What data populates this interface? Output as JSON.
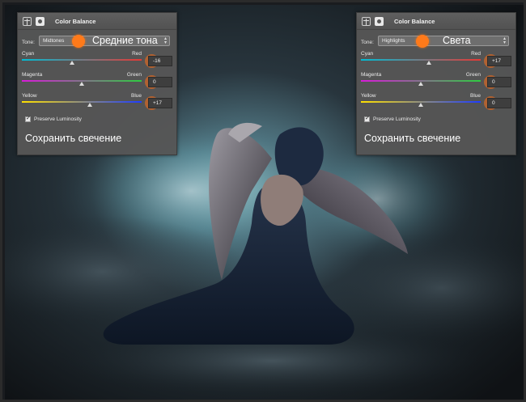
{
  "left_panel": {
    "title": "Color Balance",
    "tone_label": "Tone:",
    "tone_value": "Midtones",
    "annotation": "Средние тона",
    "sliders": [
      {
        "left": "Cyan",
        "right": "Red",
        "value": "-16",
        "position": 0.42
      },
      {
        "left": "Magenta",
        "right": "Green",
        "value": "0",
        "position": 0.5
      },
      {
        "left": "Yellow",
        "right": "Blue",
        "value": "+17",
        "position": 0.57
      }
    ],
    "preserve_label": "Preserve Luminosity",
    "preserve_checked": true,
    "preserve_annotation": "Сохранить свечение"
  },
  "right_panel": {
    "title": "Color Balance",
    "tone_label": "Tone:",
    "tone_value": "Highlights",
    "annotation": "Света",
    "sliders": [
      {
        "left": "Cyan",
        "right": "Red",
        "value": "+17",
        "position": 0.57
      },
      {
        "left": "Magenta",
        "right": "Green",
        "value": "0",
        "position": 0.5
      },
      {
        "left": "Yellow",
        "right": "Blue",
        "value": "0",
        "position": 0.5
      }
    ],
    "preserve_label": "Preserve Luminosity",
    "preserve_checked": true,
    "preserve_annotation": "Сохранить свечение"
  },
  "colors": {
    "accent": "#ff7a1a",
    "cyan_red": [
      "#00bcd4",
      "#e53935"
    ],
    "magenta_green": [
      "#d81bd8",
      "#2ecc40"
    ],
    "yellow_blue": [
      "#ffe000",
      "#1e3cff"
    ]
  }
}
